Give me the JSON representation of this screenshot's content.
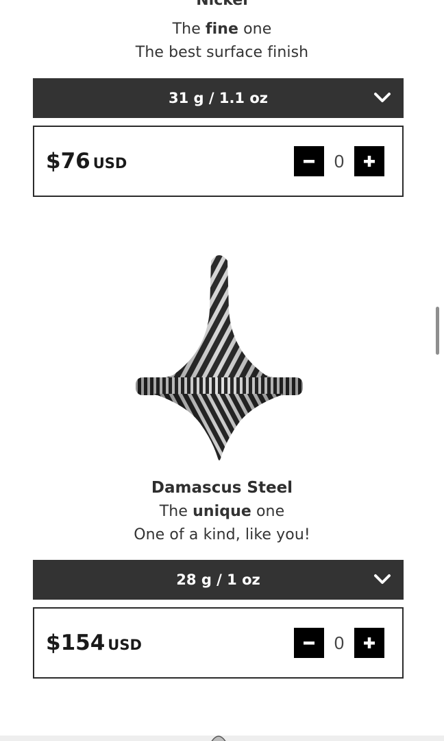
{
  "products": [
    {
      "name": "Nickel",
      "tagline_pre": "The ",
      "tagline_bold": "fine",
      "tagline_post": " one",
      "description": "The best surface finish",
      "weight": "31 g / 1.1 oz",
      "price": "$76",
      "currency": "USD",
      "quantity": "0"
    },
    {
      "name": "Damascus Steel",
      "tagline_pre": "The ",
      "tagline_bold": "unique",
      "tagline_post": " one",
      "description": "One of a kind, like you!",
      "weight": "28 g / 1 oz",
      "price": "$154",
      "currency": "USD",
      "quantity": "0"
    }
  ],
  "icons": {
    "dropdown": "chevron-down-icon",
    "decrement": "minus-icon",
    "increment": "plus-icon"
  },
  "colors": {
    "select_bg": "#333333",
    "button_bg": "#000000",
    "border": "#2b2b2b"
  }
}
